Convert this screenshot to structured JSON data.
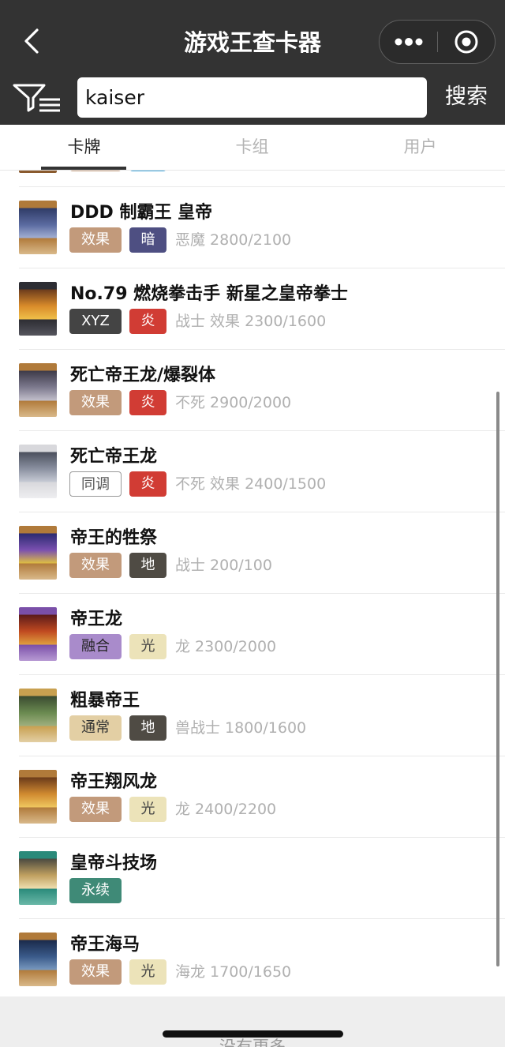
{
  "header": {
    "title": "游戏王查卡器",
    "search_value": "kaiser",
    "search_button": "搜索"
  },
  "tabs": [
    {
      "label": "卡牌"
    },
    {
      "label": "卡组"
    },
    {
      "label": "用户"
    }
  ],
  "cards": [
    {
      "name": "DDD 制霸王 皇帝",
      "tag1": "效果",
      "tag2": "暗",
      "info": "恶魔 2800/2100"
    },
    {
      "name": "No.79 燃烧拳击手 新星之皇帝拳士",
      "tag1": "XYZ",
      "tag2": "炎",
      "info": "战士 效果 2300/1600"
    },
    {
      "name": "死亡帝王龙/爆裂体",
      "tag1": "效果",
      "tag2": "炎",
      "info": "不死 2900/2000"
    },
    {
      "name": "死亡帝王龙",
      "tag1": "同调",
      "tag2": "炎",
      "info": "不死 效果 2400/1500"
    },
    {
      "name": "帝王的牲祭",
      "tag1": "效果",
      "tag2": "地",
      "info": "战士 200/100"
    },
    {
      "name": "帝王龙",
      "tag1": "融合",
      "tag2": "光",
      "info": "龙 2300/2000"
    },
    {
      "name": "粗暴帝王",
      "tag1": "通常",
      "tag2": "地",
      "info": "兽战士 1800/1600"
    },
    {
      "name": "帝王翔风龙",
      "tag1": "效果",
      "tag2": "光",
      "info": "龙 2400/2200"
    },
    {
      "name": "皇帝斗技场",
      "tag1": "永续",
      "tag2": "",
      "info": ""
    },
    {
      "name": "帝王海马",
      "tag1": "效果",
      "tag2": "光",
      "info": "海龙 1700/1650"
    }
  ],
  "footer": {
    "text": "没有更多"
  },
  "colors": {
    "header_bg": "#333333",
    "effect": "#c29a7b",
    "xyz": "#444444",
    "fusion": "#a98bcb",
    "normal": "#e3cfa4",
    "continuous": "#3f8a77",
    "dark": "#4e4f82",
    "fire": "#d13c34",
    "earth": "#4f4b44",
    "light": "#ece3b9"
  },
  "icons": [
    "chevron-left-icon",
    "more-dots-icon",
    "target-circle-icon",
    "filter-icon"
  ]
}
